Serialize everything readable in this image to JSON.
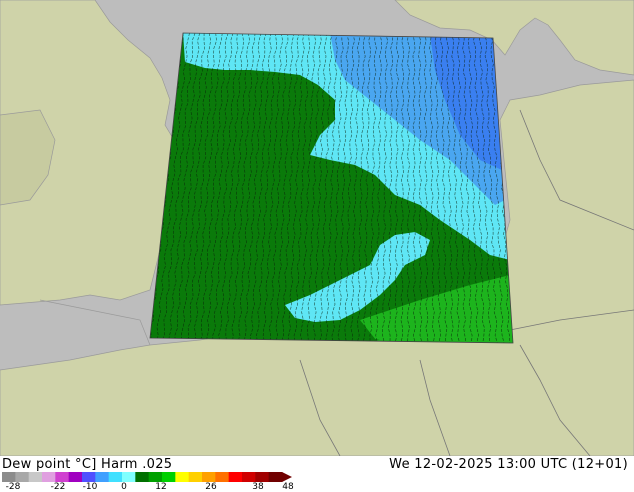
{
  "header": {
    "title": "Dew point °C] Harm .025",
    "datetime": "We 12-02-2025 13:00 UTC (12+01)"
  },
  "legend": {
    "ticks": [
      "-28",
      "-22",
      "-10",
      "0",
      "12",
      "26",
      "38",
      "48"
    ],
    "colors": [
      "#8c8c8c",
      "#a8a8a8",
      "#c8c8c8",
      "#e0a0e0",
      "#d040d0",
      "#a000c0",
      "#5050ff",
      "#40a0ff",
      "#40e0ff",
      "#80ffff",
      "#007000",
      "#00a000",
      "#00d000",
      "#ffff00",
      "#ffd000",
      "#ffa000",
      "#ff7000",
      "#ff0000",
      "#d00000",
      "#a00000",
      "#700000"
    ]
  },
  "map": {
    "colors": {
      "sea": "#bdbdbd",
      "land": "#cfd3a9",
      "green_field": "#0a7a0a",
      "bright_green": "#22c322",
      "cyan_field": "#5fe6f5",
      "blue_field": "#4aa6f0",
      "deep_blue_field": "#3a7ff0"
    }
  }
}
